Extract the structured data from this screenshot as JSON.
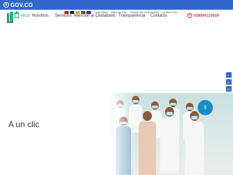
{
  "gov_bar": {
    "logo_text": "GOV.CO"
  },
  "utility": {
    "flags": [
      {
        "name": "flag-1",
        "color": "#c8102e"
      },
      {
        "name": "flag-2",
        "color": "#012169"
      },
      {
        "name": "flag-3",
        "color": "#e5b000"
      },
      {
        "name": "flag-4",
        "color": "#ce1126"
      },
      {
        "name": "flag-5",
        "color": "#003893"
      }
    ],
    "links": [
      "Intranet",
      "Aula virtual",
      "Mapa del Sitio",
      "Gestión del Conocimiento",
      "La María Kids"
    ]
  },
  "nav": {
    "home_label": "Inicio",
    "items": [
      "Nosotros",
      "Servicios",
      "Atención al Ciudadano",
      "Transparencia",
      "Contacto"
    ],
    "phone": "018004133628"
  },
  "hero": {
    "headline": "A un clic"
  },
  "colors": {
    "brand_green": "#1f9d75",
    "gov_blue": "#3366cc",
    "phone_red": "#e52d27"
  }
}
